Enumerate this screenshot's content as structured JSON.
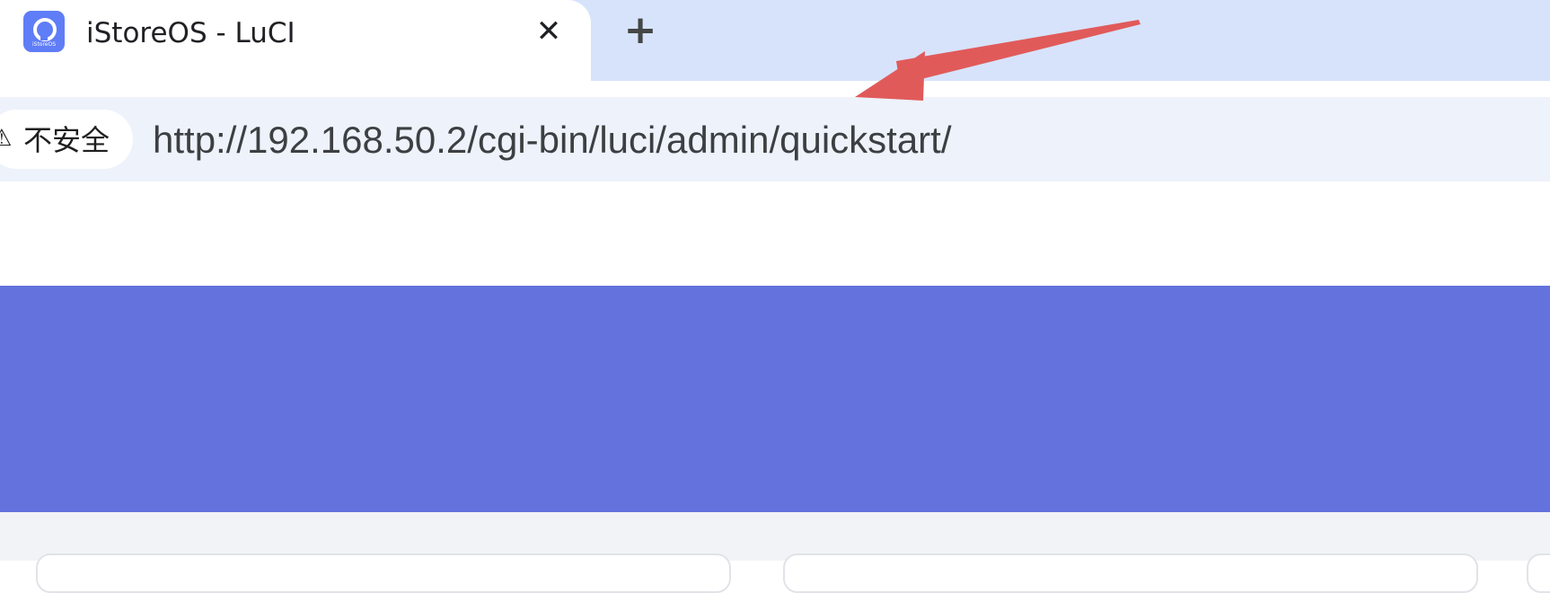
{
  "browser": {
    "tab": {
      "title": "iStoreOS - LuCI",
      "close_label": "✕",
      "favicon": {
        "icon": "istore-logo-icon",
        "brand_text": "iStoreOS",
        "color": "#5f7df6"
      }
    },
    "new_tab_label": "+",
    "address_bar": {
      "security_icon": "warning-triangle-icon",
      "security_label": "不安全",
      "url": "http://192.168.50.2/cgi-bin/luci/admin/quickstart/"
    }
  },
  "annotation": {
    "type": "arrow",
    "color": "#e15a5a",
    "points_to": "address_bar.url"
  },
  "page": {
    "header_color": "#6372dc",
    "body_color": "#f2f3f6"
  }
}
